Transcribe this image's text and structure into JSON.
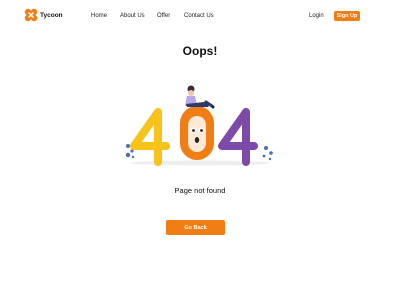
{
  "brand": {
    "name": "Tycoon",
    "accent": "#f07e14"
  },
  "nav": {
    "links": [
      "Home",
      "About Us",
      "Offer",
      "Contact Us"
    ],
    "login": "Login",
    "signup": "Sign Up"
  },
  "main": {
    "title": "Oops!",
    "error_digits": [
      "4",
      "0",
      "4"
    ],
    "message": "Page not found",
    "button": "Go Back"
  },
  "colors": {
    "digit_left": "#f7c21a",
    "digit_middle": "#f07e14",
    "digit_right": "#7d4aa8",
    "dots": "#4a6fc2"
  }
}
